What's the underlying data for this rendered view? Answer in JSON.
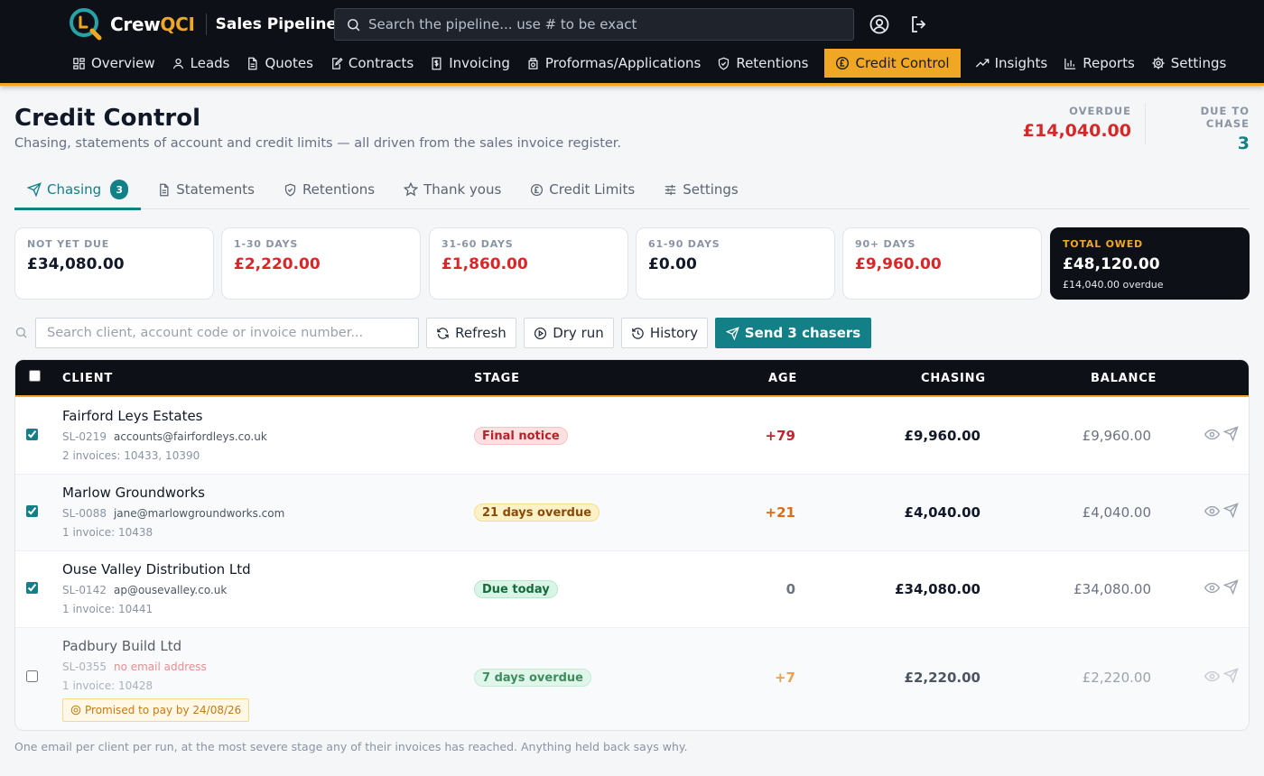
{
  "header": {
    "brand_prefix": "Crew",
    "brand_suffix": "QCI",
    "app_name": "Sales Pipeline",
    "search_placeholder": "Search the pipeline... use # to be exact",
    "accent": "#f0a824"
  },
  "nav": [
    {
      "label": "Overview",
      "icon": "grid-icon"
    },
    {
      "label": "Leads",
      "icon": "user-icon"
    },
    {
      "label": "Quotes",
      "icon": "document-icon"
    },
    {
      "label": "Contracts",
      "icon": "contract-icon"
    },
    {
      "label": "Invoicing",
      "icon": "invoice-icon"
    },
    {
      "label": "Proformas/Applications",
      "icon": "proforma-icon"
    },
    {
      "label": "Retentions",
      "icon": "shield-icon"
    },
    {
      "label": "Credit Control",
      "icon": "pound-icon",
      "active": true
    },
    {
      "label": "Insights",
      "icon": "trend-icon"
    },
    {
      "label": "Reports",
      "icon": "bar-chart-icon"
    },
    {
      "label": "Settings",
      "icon": "gear-icon"
    }
  ],
  "page": {
    "title": "Credit Control",
    "subtitle": "Chasing, statements of account and credit limits — all driven from the sales invoice register.",
    "overdue_label": "OVERDUE",
    "overdue_value": "£14,040.00",
    "due_label": "DUE TO CHASE",
    "due_value": "3"
  },
  "tabs": [
    {
      "label": "Chasing",
      "badge": "3",
      "active": true
    },
    {
      "label": "Statements"
    },
    {
      "label": "Retentions"
    },
    {
      "label": "Thank yous"
    },
    {
      "label": "Credit Limits"
    },
    {
      "label": "Settings"
    }
  ],
  "aging": [
    {
      "label": "NOT YET DUE",
      "value": "£34,080.00",
      "color": "#111827"
    },
    {
      "label": "1-30 DAYS",
      "value": "£2,220.00",
      "color": "#d62828"
    },
    {
      "label": "31-60 DAYS",
      "value": "£1,860.00",
      "color": "#d62828"
    },
    {
      "label": "61-90 DAYS",
      "value": "£0.00",
      "color": "#111827"
    },
    {
      "label": "90+ DAYS",
      "value": "£9,960.00",
      "color": "#d62828"
    },
    {
      "label": "TOTAL OWED",
      "value": "£48,120.00",
      "note": "£14,040.00 overdue"
    }
  ],
  "toolbar": {
    "search_placeholder": "Search client, account code or invoice number...",
    "refresh": "Refresh",
    "dry_run": "Dry run",
    "history": "History",
    "send": "Send 3 chasers"
  },
  "table": {
    "columns": [
      "CLIENT",
      "STAGE",
      "AGE",
      "CHASING",
      "BALANCE"
    ],
    "rows": [
      {
        "client": "Fairford Leys Estates",
        "code": "SL-0219",
        "email": "accounts@fairfordleys.co.uk",
        "invoices": "2 invoices: 10433, 10390",
        "stage": "Final notice",
        "age": "+79",
        "chasing": "£9,960.00",
        "balance": "£9,960.00",
        "checked": true
      },
      {
        "client": "Marlow Groundworks",
        "code": "SL-0088",
        "email": "jane@marlowgroundworks.com",
        "invoices": "1 invoice: 10438",
        "stage": "21 days overdue",
        "age": "+21",
        "chasing": "£4,040.00",
        "balance": "£4,040.00",
        "checked": true
      },
      {
        "client": "Ouse Valley Distribution Ltd",
        "code": "SL-0142",
        "email": "ap@ousevalley.co.uk",
        "invoices": "1 invoice: 10441",
        "stage": "Due today",
        "age": "0",
        "chasing": "£34,080.00",
        "balance": "£34,080.00",
        "checked": true
      },
      {
        "client": "Padbury Build Ltd",
        "code": "SL-0355",
        "email": "no email address",
        "invoices": "1 invoice: 10428",
        "stage": "7 days overdue",
        "age": "+7",
        "chasing": "£2,220.00",
        "balance": "£2,220.00",
        "checked": false,
        "promise": "Promised to pay by 24/08/26"
      }
    ]
  },
  "footer_note": "One email per client per run, at the most severe stage any of their invoices has reached. Anything held back says why."
}
